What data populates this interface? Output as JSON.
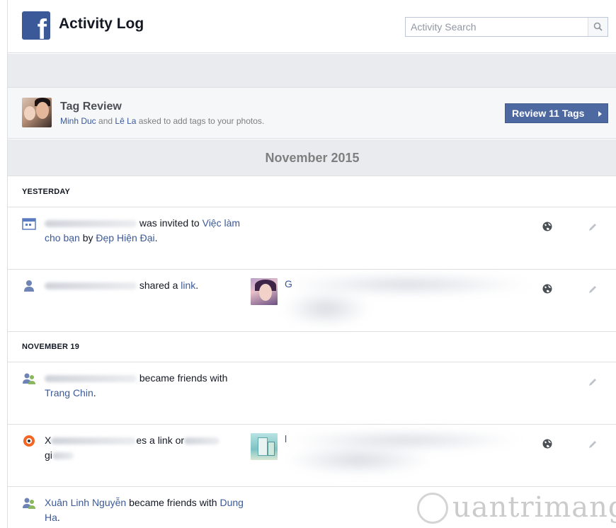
{
  "header": {
    "logo_letter": "f",
    "title": "Activity Log",
    "search_placeholder": "Activity Search"
  },
  "tag_review": {
    "title": "Tag Review",
    "name1": "Minh Duc",
    "and": " and ",
    "name2": "Lê La",
    "suffix": " asked to add tags to your photos.",
    "button_label": "Review 11 Tags"
  },
  "month": "November 2015",
  "sections": [
    {
      "label": "YESTERDAY"
    },
    {
      "label": "NOVEMBER 19"
    }
  ],
  "entries": [
    {
      "action": "was invited to ",
      "target": "Việc làm cho bạn",
      "by": " by ",
      "target2": "Đẹp Hiện Đại",
      "end": "."
    },
    {
      "action": "shared a ",
      "target": "link",
      "end": ".",
      "preview_initial": "G"
    },
    {
      "action": "became friends with ",
      "target": "Trang Chin",
      "end": "."
    },
    {
      "fragment1": "X",
      "fragment2": "es a link or",
      "fragment3": "gi",
      "preview_initial": "l"
    },
    {
      "name": "Xuân Linh Nguyễn",
      "action": " became friends with ",
      "target": "Dung Ha",
      "end": "."
    }
  ],
  "watermark": "uantrimang",
  "colors": {
    "brand": "#3b5998",
    "button": "#4e69a2",
    "band": "#e9ebee",
    "link": "#3b5998"
  }
}
